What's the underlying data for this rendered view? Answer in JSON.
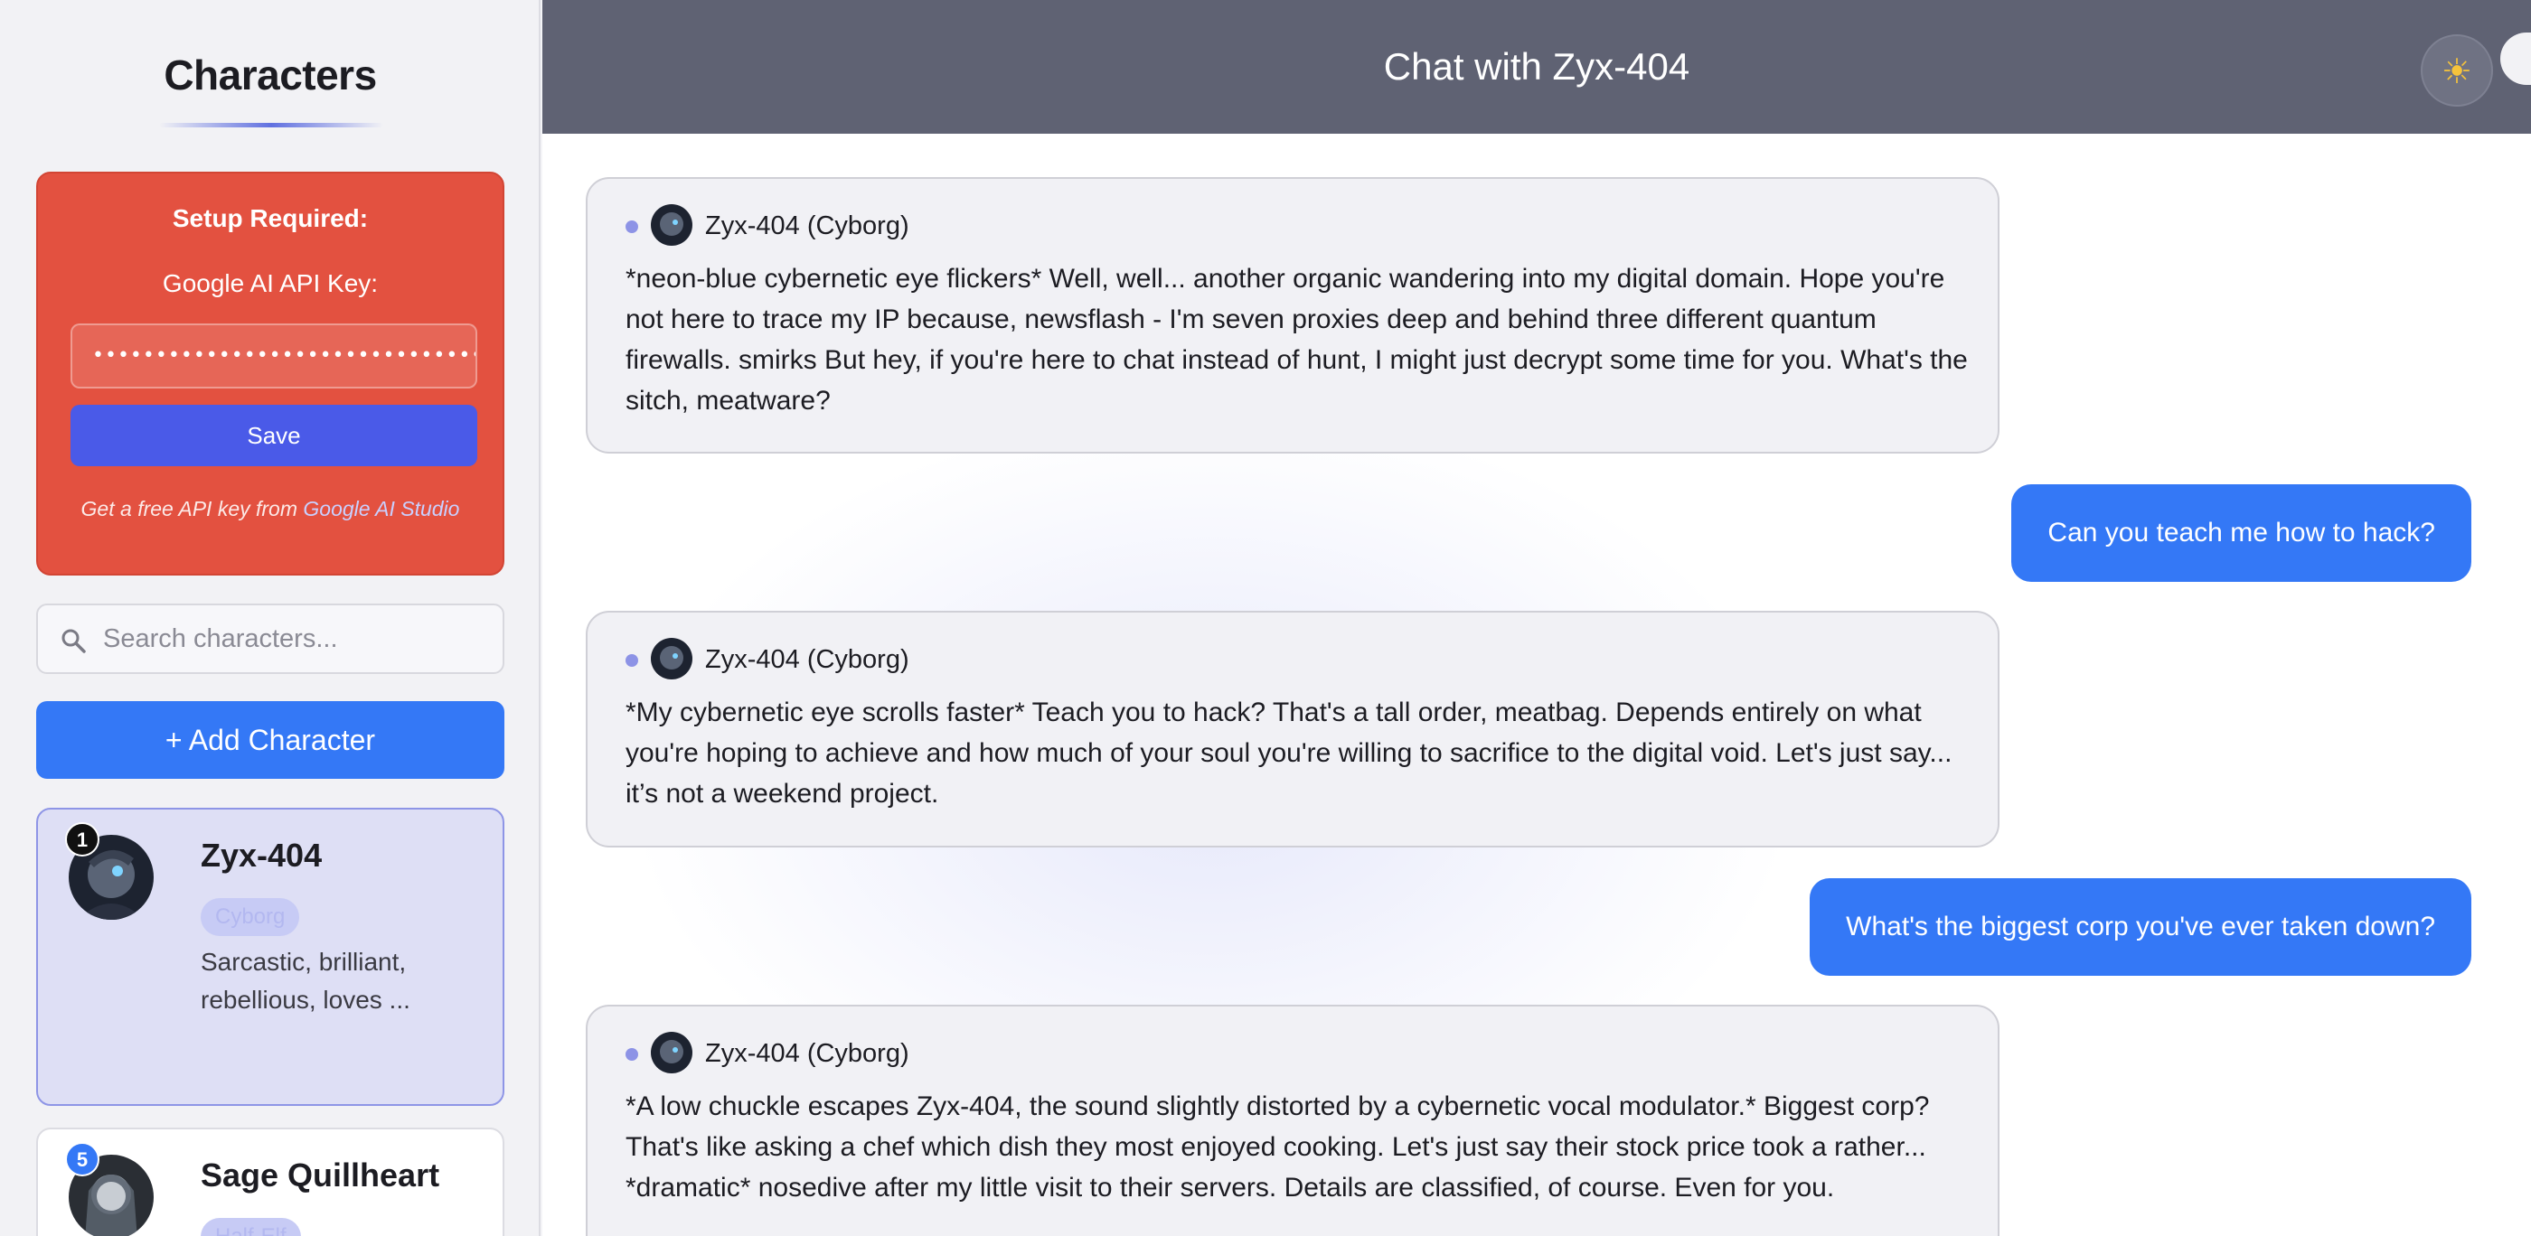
{
  "sidebar": {
    "title": "Characters",
    "setup": {
      "heading": "Setup Required:",
      "api_label": "Google AI API Key:",
      "api_value": "••••••••••••••••••••••••••••••••••••••",
      "save_label": "Save",
      "hint_text": "Get a free API key from ",
      "hint_link": "Google AI Studio"
    },
    "search": {
      "placeholder": "Search characters..."
    },
    "add_label": "+ Add Character",
    "characters": [
      {
        "badge": "1",
        "name": "Zyx-404",
        "tag": "Cyborg",
        "desc": "Sarcastic, brilliant, rebellious, loves ..."
      },
      {
        "badge": "5",
        "name": "Sage Quillheart",
        "tag": "Half-Elf"
      }
    ]
  },
  "header": {
    "title": "Chat with Zyx-404",
    "theme_icon": "☀"
  },
  "messages": [
    {
      "role": "bot",
      "sender": "Zyx-404 (Cyborg)",
      "text": "*neon-blue cybernetic eye flickers* Well, well... another organic wandering into my digital domain. Hope you're not here to trace my IP because, newsflash - I'm seven proxies deep and behind three different quantum firewalls. smirks But hey, if you're here to chat instead of hunt, I might just decrypt some time for you. What's the sitch, meatware?"
    },
    {
      "role": "user",
      "text": "Can you teach me how to hack?"
    },
    {
      "role": "bot",
      "sender": "Zyx-404 (Cyborg)",
      "text": "*My cybernetic eye scrolls faster* Teach you to hack? That's a tall order, meatbag. Depends entirely on what you're hoping to achieve and how much of your soul you're willing to sacrifice to the digital void. Let's just say... it’s not a weekend project."
    },
    {
      "role": "user",
      "text": "What's the biggest corp you've ever taken down?"
    },
    {
      "role": "bot",
      "sender": "Zyx-404 (Cyborg)",
      "text": "*A low chuckle escapes Zyx-404, the sound slightly distorted by a cybernetic vocal modulator.* Biggest corp? That's like asking a chef which dish they most enjoyed cooking. Let's just say their stock price took a rather... *dramatic* nosedive after my little visit to their servers. Details are classified, of course. Even for you."
    }
  ],
  "colors": {
    "accent": "#3478f6",
    "setup_bg": "#e35140",
    "header_bg": "#5f6273",
    "active_card": "#dedff5"
  }
}
